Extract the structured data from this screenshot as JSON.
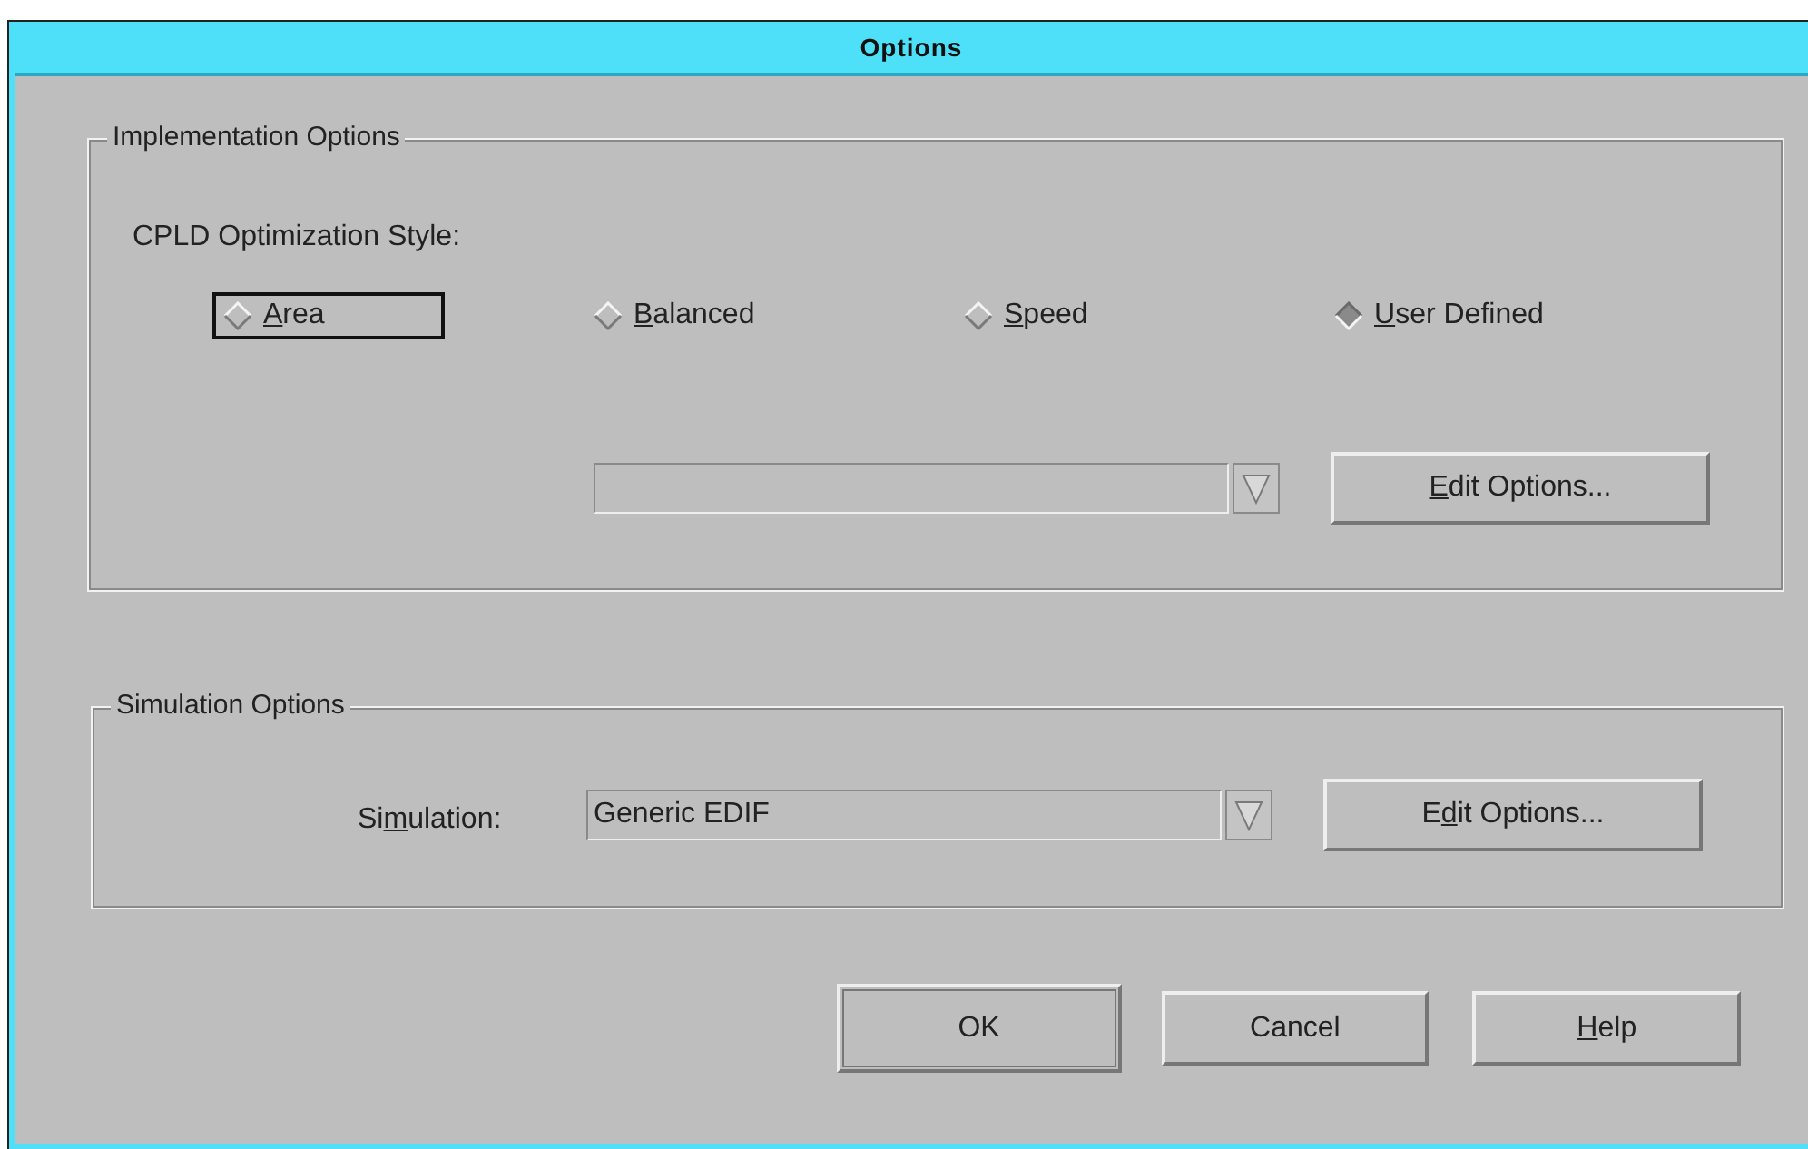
{
  "window": {
    "title": "Options"
  },
  "implementation": {
    "legend": "Implementation Options",
    "style_label": "CPLD Optimization Style:",
    "radios": [
      {
        "key": "A",
        "after": "rea",
        "selected": false,
        "focused": true
      },
      {
        "key": "B",
        "after": "alanced",
        "selected": false,
        "focused": false
      },
      {
        "key": "S",
        "after": "peed",
        "selected": false,
        "focused": false
      },
      {
        "key": "U",
        "after": "ser Defined",
        "selected": true,
        "focused": false
      }
    ],
    "edit_button": {
      "key": "E",
      "after": "dit Options..."
    }
  },
  "simulation": {
    "legend": "Simulation Options",
    "label": {
      "before": "Si",
      "key": "m",
      "after": "ulation:"
    },
    "combo": {
      "value": "Generic EDIF"
    },
    "edit_button": {
      "before": "E",
      "key": "d",
      "after": "it Options..."
    }
  },
  "buttons": [
    {
      "after": "OK",
      "default": true
    },
    {
      "after": "Cancel",
      "default": false
    },
    {
      "key": "H",
      "after": "elp",
      "default": false
    }
  ]
}
